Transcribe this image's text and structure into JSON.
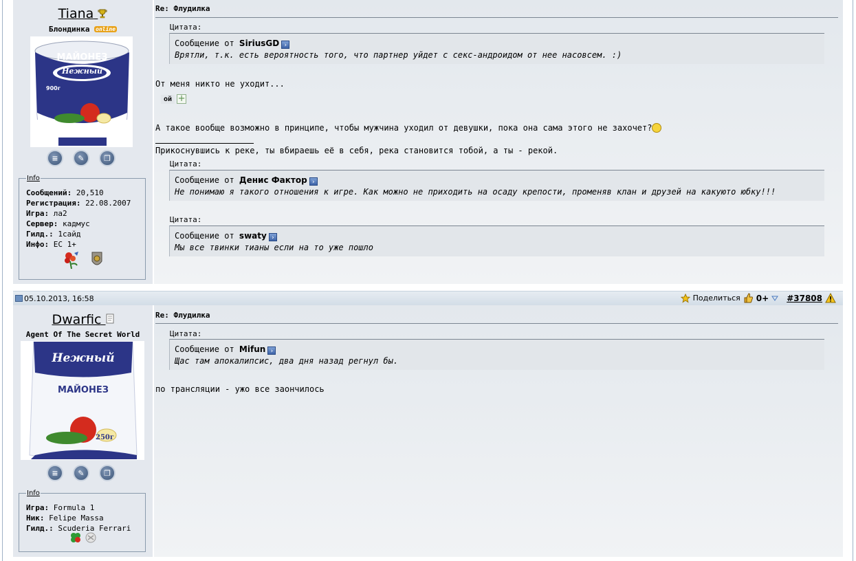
{
  "post1": {
    "username": "Tiana",
    "user_title": "Блондинка",
    "status_badge": "online",
    "info_legend": "Info",
    "info": [
      {
        "label": "Сообщений:",
        "value": " 20,510"
      },
      {
        "label": "Регистрация:",
        "value": " 22.08.2007"
      },
      {
        "label": "Игра:",
        "value": " ла2"
      },
      {
        "label": "Сервер:",
        "value": " кадмус"
      },
      {
        "label": "Гилд.:",
        "value": " 1сайд"
      },
      {
        "label": "Инфо:",
        "value": " ЕС 1+"
      }
    ],
    "avatar": {
      "line1": "МАЙОНЕЗ",
      "line2": "Нежный",
      "weight": "900г"
    },
    "title": "Re: Флудилка",
    "quote_label": "Цитата:",
    "quote_from_prefix": "Сообщение от ",
    "quote1_author": "SiriusGD",
    "quote1_text": "Врятли, т.к. есть вероятность того, что партнер уйдет с секс-андроидом от нее насовсем. :)",
    "text1": "От меня никто не уходит...",
    "spoiler_label": "ой",
    "text2": "А такое вообще возможно в принципе, чтобы мужчина уходил от девушки, пока она сама этого не захочет?",
    "signature": "Прикоснувшись к реке, ты вбираешь её в себя, река становится тобой, а ты - рекой.",
    "quote2_author": "Денис Фактор",
    "quote2_text": "Не понимаю я такого отношения к игре. Как можно не приходить на осаду крепости, променяв клан и друзей на какуюто юбку!!!",
    "quote3_author": "swaty",
    "quote3_text": "Мы все твинки тианы если на то уже пошло"
  },
  "post2": {
    "date": "05.10.2013, 16:58",
    "share": "Поделиться",
    "rating": "0+",
    "post_number": "#37808",
    "username": "Dwarfic",
    "user_title": "Agent Of The Secret World",
    "info_legend": "Info",
    "info": [
      {
        "label": "Игра:",
        "value": " Formula 1"
      },
      {
        "label": "Ник:",
        "value": " Felipe Massa"
      },
      {
        "label": "Гилд.:",
        "value": " Scuderia Ferrari"
      }
    ],
    "avatar": {
      "line1": "Нежный",
      "line2": "МАЙОНЕЗ",
      "weight": "250г"
    },
    "title": "Re: Флудилка",
    "quote_label": "Цитата:",
    "quote_from_prefix": "Сообщение от ",
    "quote1_author": "Mifun",
    "quote1_text": "Щас там апокалипсис, два дня назад регнул бы.",
    "text1": "по трансляции - ужо все заончилось"
  },
  "colors": {
    "avatar_blue": "#2c3587",
    "tomato": "#d42b1e",
    "cucumber": "#3f8a2e"
  }
}
